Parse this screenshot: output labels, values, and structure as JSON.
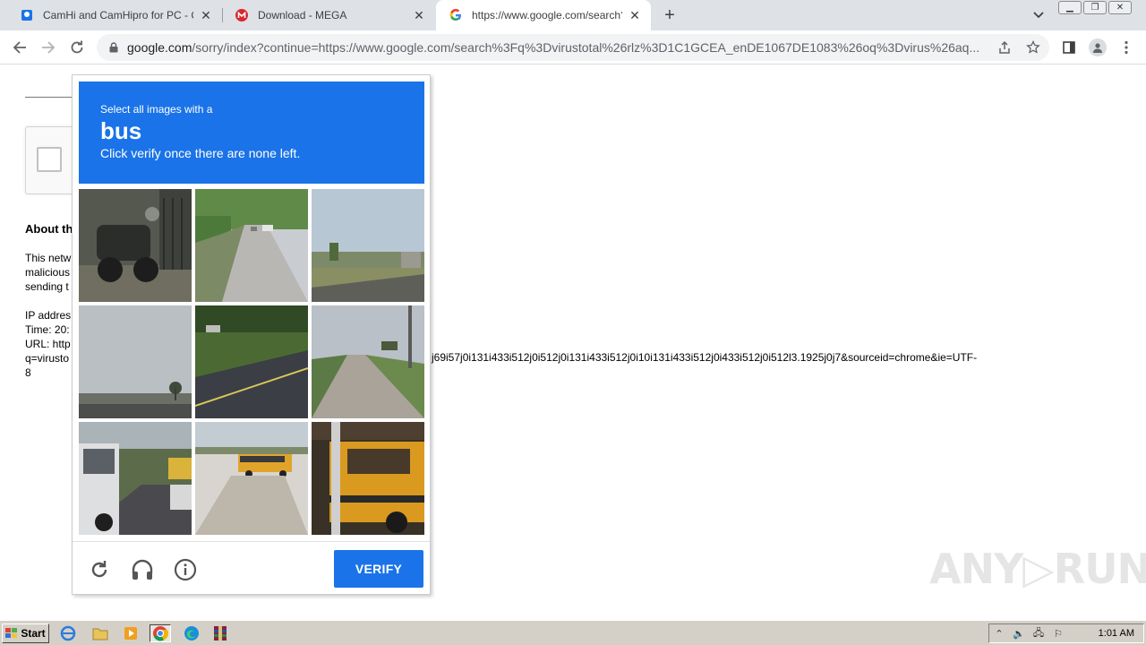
{
  "browser": {
    "tabs": [
      {
        "title": "CamHi and CamHipro for PC - Camhi",
        "favicon": "camhi-favicon",
        "active": false
      },
      {
        "title": "Download - MEGA",
        "favicon": "mega-favicon",
        "active": false
      },
      {
        "title": "https://www.google.com/search?q=",
        "favicon": "google-favicon",
        "active": true
      }
    ],
    "new_tab_label": "+",
    "address_host": "google.com",
    "address_path": "/sorry/index?continue=https://www.google.com/search%3Fq%3Dvirustotal%26rlz%3D1C1GCEA_enDE1067DE1083%26oq%3Dvirus%26aq..."
  },
  "page": {
    "about_title": "About th",
    "para1": [
      "This netw",
      "malicious",
      "sending t"
    ],
    "para2": [
      "IP addres",
      "Time: 20:",
      "URL: http",
      "q=virusto",
      "8"
    ],
    "url_tail": "j69i57j0i131i433i512j0i512j0i131i433i512j0i10i131i433i512j0i433i512j0i512l3.1925j0j7&sourceid=chrome&ie=UTF-"
  },
  "captcha": {
    "instruction_line1": "Select all images with a",
    "target": "bus",
    "instruction_line3": "Click verify once there are none left.",
    "verify_label": "VERIFY",
    "tiles": [
      "motorcycle-tile",
      "road-tile",
      "field-tile",
      "sky-tile",
      "highway-tile",
      "road-pole-tile",
      "bus-white-tile",
      "school-bus-tile",
      "school-bus-close-tile"
    ]
  },
  "watermark": "ANY▷RUN",
  "taskbar": {
    "start_label": "Start",
    "clock": "1:01 AM"
  },
  "colors": {
    "captcha_blue": "#1a73e8",
    "tab_strip": "#dee1e6",
    "taskbar": "#d4d0c8"
  }
}
